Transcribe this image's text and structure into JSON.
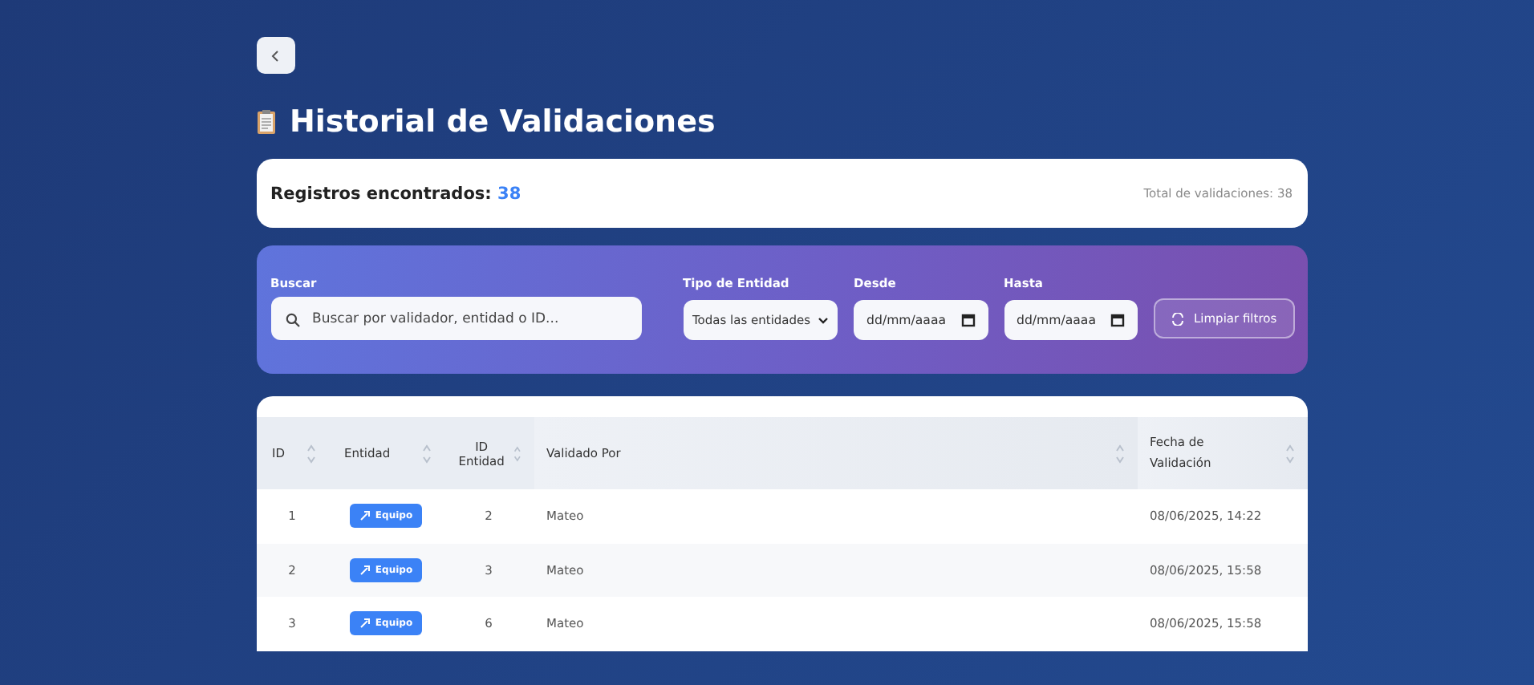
{
  "title": "Historial de Validaciones",
  "summary": {
    "label": "Registros encontrados:",
    "count": "38",
    "total": "Total de validaciones: 38"
  },
  "filters": {
    "search": {
      "label": "Buscar",
      "placeholder": "Buscar por validador, entidad o ID..."
    },
    "entity_type": {
      "label": "Tipo de Entidad",
      "value": "Todas las entidades"
    },
    "from": {
      "label": "Desde",
      "value": "dd/mm/aaaa"
    },
    "to": {
      "label": "Hasta",
      "value": "dd/mm/aaaa"
    },
    "clear_button": "Limpiar filtros"
  },
  "table": {
    "columns": [
      "ID",
      "Entidad",
      "ID Entidad",
      "Validado Por",
      "Fecha de Validación"
    ],
    "rows": [
      {
        "id": "1",
        "entity": "Equipo",
        "entity_id": "2",
        "validated_by": "Mateo",
        "date": "08/06/2025, 14:22"
      },
      {
        "id": "2",
        "entity": "Equipo",
        "entity_id": "3",
        "validated_by": "Mateo",
        "date": "08/06/2025, 15:58"
      },
      {
        "id": "3",
        "entity": "Equipo",
        "entity_id": "6",
        "validated_by": "Mateo",
        "date": "08/06/2025, 15:58"
      }
    ]
  }
}
